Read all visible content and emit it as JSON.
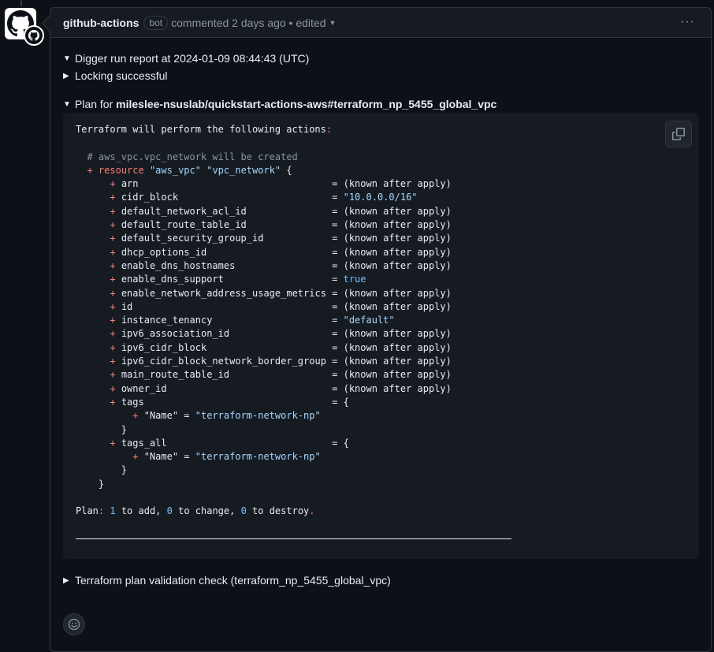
{
  "comment": {
    "author": "github-actions",
    "badge": "bot",
    "meta": "commented 2 days ago • edited",
    "more_icon": "kebab-horizontal-icon"
  },
  "sections": {
    "run_report": "Digger run report at 2024-01-09 08:44:43 (UTC)",
    "locking": "Locking successful",
    "plan_prefix": "Plan for ",
    "plan_target": "mileslee-nsuslab/quickstart-actions-aws#terraform_np_5455_global_vpc",
    "validation": "Terraform plan validation check (terraform_np_5455_global_vpc)"
  },
  "code": {
    "intro": "Terraform will perform the following actions",
    "intro_colon": ":",
    "comment": "# aws_vpc.vpc_network will be created",
    "resource_plus": "+",
    "resource_kw": "resource",
    "resource_type": "\"aws_vpc\"",
    "resource_name": "\"vpc_network\"",
    "resource_open": "{",
    "attributes": [
      {
        "name": "arn",
        "value": "(known after apply)",
        "kind": "plain"
      },
      {
        "name": "cidr_block",
        "value": "\"10.0.0.0/16\"",
        "kind": "str"
      },
      {
        "name": "default_network_acl_id",
        "value": "(known after apply)",
        "kind": "plain"
      },
      {
        "name": "default_route_table_id",
        "value": "(known after apply)",
        "kind": "plain"
      },
      {
        "name": "default_security_group_id",
        "value": "(known after apply)",
        "kind": "plain"
      },
      {
        "name": "dhcp_options_id",
        "value": "(known after apply)",
        "kind": "plain"
      },
      {
        "name": "enable_dns_hostnames",
        "value": "(known after apply)",
        "kind": "plain"
      },
      {
        "name": "enable_dns_support",
        "value": "true",
        "kind": "bool"
      },
      {
        "name": "enable_network_address_usage_metrics",
        "value": "(known after apply)",
        "kind": "plain"
      },
      {
        "name": "id",
        "value": "(known after apply)",
        "kind": "plain"
      },
      {
        "name": "instance_tenancy",
        "value": "\"default\"",
        "kind": "str"
      },
      {
        "name": "ipv6_association_id",
        "value": "(known after apply)",
        "kind": "plain"
      },
      {
        "name": "ipv6_cidr_block",
        "value": "(known after apply)",
        "kind": "plain"
      },
      {
        "name": "ipv6_cidr_block_network_border_group",
        "value": "(known after apply)",
        "kind": "plain"
      },
      {
        "name": "main_route_table_id",
        "value": "(known after apply)",
        "kind": "plain"
      },
      {
        "name": "owner_id",
        "value": "(known after apply)",
        "kind": "plain"
      },
      {
        "name": "tags",
        "value": "{",
        "kind": "plain",
        "map": {
          "key": "\"Name\"",
          "value": "\"terraform-network-np\""
        }
      },
      {
        "name": "tags_all",
        "value": "{",
        "kind": "plain",
        "map": {
          "key": "\"Name\"",
          "value": "\"terraform-network-np\""
        }
      }
    ],
    "close_brace": "}",
    "plan_summary": {
      "label": "Plan",
      "add": "1",
      "change": "0",
      "destroy": "0",
      "add_text": " to add, ",
      "change_text": " to change, ",
      "destroy_text": " to destroy",
      "end": "."
    },
    "copy_icon": "copy-icon"
  },
  "reaction": {
    "icon": "smiley-icon"
  }
}
